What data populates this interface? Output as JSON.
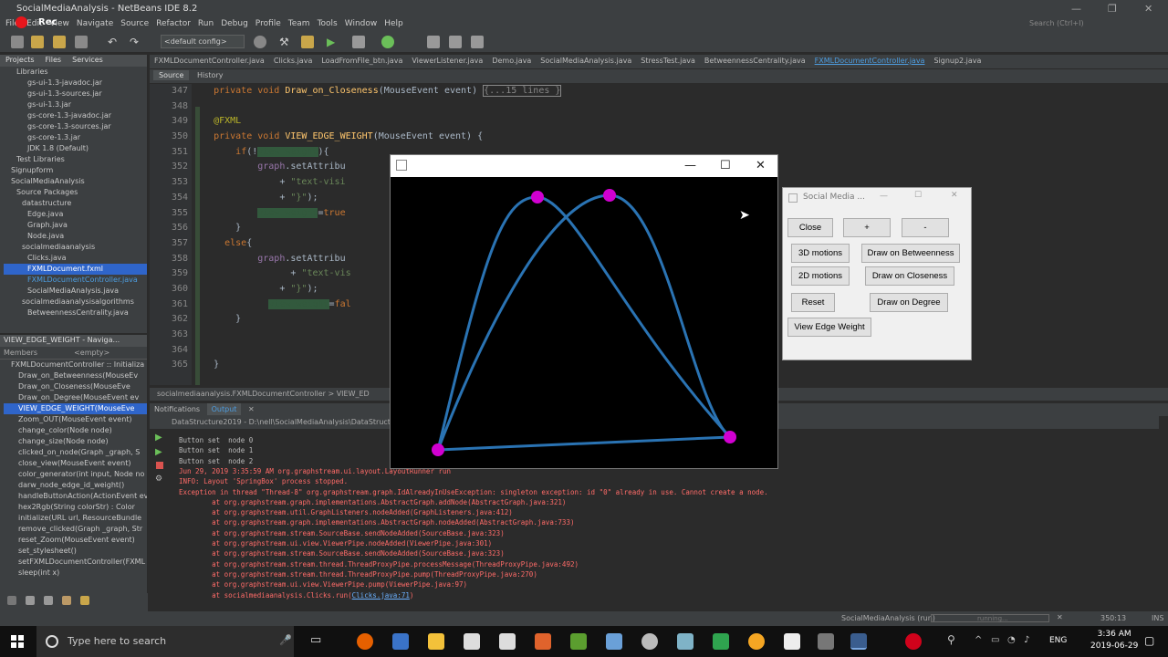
{
  "window": {
    "title": "SocialMediaAnalysis - NetBeans IDE 8.2",
    "rec_label": "Rec",
    "search_placeholder": "Search (Ctrl+I)"
  },
  "menu": [
    "File",
    "Edit",
    "View",
    "Navigate",
    "Source",
    "Refactor",
    "Run",
    "Debug",
    "Profile",
    "Team",
    "Tools",
    "Window",
    "Help"
  ],
  "toolbar": {
    "config": "<default config>"
  },
  "projects": {
    "tabs": [
      "Projects",
      "Files",
      "Services"
    ],
    "items": [
      {
        "label": "Libraries",
        "cls": ""
      },
      {
        "label": "gs-ui-1.3-javadoc.jar",
        "cls": ""
      },
      {
        "label": "gs-ui-1.3-sources.jar",
        "cls": ""
      },
      {
        "label": "gs-ui-1.3.jar",
        "cls": ""
      },
      {
        "label": "gs-core-1.3-javadoc.jar",
        "cls": ""
      },
      {
        "label": "gs-core-1.3-sources.jar",
        "cls": ""
      },
      {
        "label": "gs-core-1.3.jar",
        "cls": ""
      },
      {
        "label": "JDK 1.8 (Default)",
        "cls": ""
      },
      {
        "label": "Test Libraries",
        "cls": ""
      },
      {
        "label": "Signupform",
        "cls": ""
      },
      {
        "label": "SocialMediaAnalysis",
        "cls": ""
      },
      {
        "label": "Source Packages",
        "cls": ""
      },
      {
        "label": "datastructure",
        "cls": ""
      },
      {
        "label": "Edge.java",
        "cls": ""
      },
      {
        "label": "Graph.java",
        "cls": ""
      },
      {
        "label": "Node.java",
        "cls": ""
      },
      {
        "label": "socialmediaanalysis",
        "cls": ""
      },
      {
        "label": "Clicks.java",
        "cls": ""
      },
      {
        "label": "FXMLDocument.fxml",
        "cls": "sel"
      },
      {
        "label": "FXMLDocumentController.java",
        "cls": "hl"
      },
      {
        "label": "SocialMediaAnalysis.java",
        "cls": ""
      },
      {
        "label": "socialmediaanalysisalgorithms",
        "cls": ""
      },
      {
        "label": "BetweennessCentrality.java",
        "cls": ""
      }
    ]
  },
  "navigator": {
    "title": "VIEW_EDGE_WEIGHT - Naviga...",
    "members": "Members",
    "filter": "<empty>",
    "items": [
      {
        "label": "FXMLDocumentController :: Initializa",
        "cls": ""
      },
      {
        "label": "Draw_on_Betweenness(MouseEv",
        "cls": ""
      },
      {
        "label": "Draw_on_Closeness(MouseEve",
        "cls": ""
      },
      {
        "label": "Draw_on_Degree(MouseEvent ev",
        "cls": ""
      },
      {
        "label": "VIEW_EDGE_WEIGHT(MouseEve",
        "cls": "sel"
      },
      {
        "label": "Zoom_OUT(MouseEvent event)",
        "cls": ""
      },
      {
        "label": "change_color(Node node)",
        "cls": ""
      },
      {
        "label": "change_size(Node node)",
        "cls": ""
      },
      {
        "label": "clicked_on_node(Graph _graph, S",
        "cls": ""
      },
      {
        "label": "close_view(MouseEvent event)",
        "cls": ""
      },
      {
        "label": "color_generator(int input, Node no",
        "cls": ""
      },
      {
        "label": "darw_node_edge_id_weight()",
        "cls": ""
      },
      {
        "label": "handleButtonAction(ActionEvent ev",
        "cls": ""
      },
      {
        "label": "hex2Rgb(String colorStr) : Color",
        "cls": ""
      },
      {
        "label": "initialize(URL url, ResourceBundle",
        "cls": ""
      },
      {
        "label": "remove_clicked(Graph _graph, Str",
        "cls": ""
      },
      {
        "label": "reset_Zoom(MouseEvent event)",
        "cls": ""
      },
      {
        "label": "set_stylesheet()",
        "cls": ""
      },
      {
        "label": "setFXMLDocumentController(FXML",
        "cls": ""
      },
      {
        "label": "sleep(int x)",
        "cls": ""
      }
    ]
  },
  "editor": {
    "tabs": [
      "FXMLDocumentController.java",
      "Clicks.java",
      "LoadFromFile_btn.java",
      "ViewerListener.java",
      "Demo.java",
      "SocialMediaAnalysis.java",
      "StressTest.java",
      "BetweennessCentrality.java",
      "FXMLDocumentController.java",
      "Signup2.java"
    ],
    "active_tab": 8,
    "source_tabs": [
      "Source",
      "History"
    ],
    "line_numbers": [
      "347",
      "348",
      "349",
      "350",
      "351",
      "352",
      "353",
      "354",
      "355",
      "356",
      "357",
      "358",
      "359",
      "360",
      "361",
      "362",
      "363",
      "364",
      "365"
    ],
    "breadcrumb": "socialmediaanalysis.FXMLDocumentController  >  VIEW_ED"
  },
  "output": {
    "tabs": [
      "Notifications",
      "Output"
    ],
    "run_title": "DataStructure2019 - D:\\nell\\SocialMediaAnalysis\\DataStructure20",
    "lines": [
      {
        "text": "Button set  node 0",
        "cls": ""
      },
      {
        "text": "Button set  node 1",
        "cls": ""
      },
      {
        "text": "Button set  node 2",
        "cls": ""
      },
      {
        "text": "Jun 29, 2019 3:35:59 AM org.graphstream.ui.layout.LayoutRunner run",
        "cls": "err"
      },
      {
        "text": "INFO: Layout 'SpringBox' process stopped.",
        "cls": "err"
      },
      {
        "text": "Exception in thread \"Thread-8\" org.graphstream.graph.IdAlreadyInUseException: singleton exception: id \"0\" already in use. Cannot create a node.",
        "cls": "err"
      },
      {
        "text": "        at org.graphstream.graph.implementations.AbstractGraph.addNode(AbstractGraph.java:321)",
        "cls": "err"
      },
      {
        "text": "        at org.graphstream.util.GraphListeners.nodeAdded(GraphListeners.java:412)",
        "cls": "err"
      },
      {
        "text": "        at org.graphstream.graph.implementations.AbstractGraph.nodeAdded(AbstractGraph.java:733)",
        "cls": "err"
      },
      {
        "text": "        at org.graphstream.stream.SourceBase.sendNodeAdded(SourceBase.java:323)",
        "cls": "err"
      },
      {
        "text": "        at org.graphstream.ui.view.ViewerPipe.nodeAdded(ViewerPipe.java:301)",
        "cls": "err"
      },
      {
        "text": "        at org.graphstream.stream.SourceBase.sendNodeAdded(SourceBase.java:323)",
        "cls": "err"
      },
      {
        "text": "        at org.graphstream.stream.thread.ThreadProxyPipe.processMessage(ThreadProxyPipe.java:492)",
        "cls": "err"
      },
      {
        "text": "        at org.graphstream.stream.thread.ThreadProxyPipe.pump(ThreadProxyPipe.java:270)",
        "cls": "err"
      },
      {
        "text": "        at org.graphstream.ui.view.ViewerPipe.pump(ViewerPipe.java:97)",
        "cls": "err"
      }
    ],
    "last_line_prefix": "        at socialmediaanalysis.Clicks.run(",
    "last_line_link": "Clicks.java:71",
    "last_line_suffix": ")"
  },
  "status": {
    "project": "SocialMediaAnalysis (run)",
    "progress_label": "running...",
    "position": "350:13",
    "mode": "INS"
  },
  "taskbar": {
    "search_placeholder": "Type here to search",
    "lang": "ENG",
    "time": "3:36 AM",
    "date": "2019-06-29"
  },
  "social_window": {
    "title": "Social Media ...",
    "buttons": {
      "close": "Close",
      "plus": "+",
      "minus": "-",
      "motions3d": "3D motions",
      "motions2d": "2D motions",
      "between": "Draw on Betweenness",
      "closeness": "Draw on Closeness",
      "reset": "Reset",
      "degree": "Draw on Degree",
      "edge_weight": "View Edge Weight"
    }
  },
  "graph_window": {
    "node_color": "#d100d1",
    "edge_color": "#2a73b3"
  },
  "colors": {
    "ide_bg": "#2b2b2b",
    "panel": "#3c3f41",
    "accent": "#4d9de0",
    "error": "#ff6b68"
  }
}
